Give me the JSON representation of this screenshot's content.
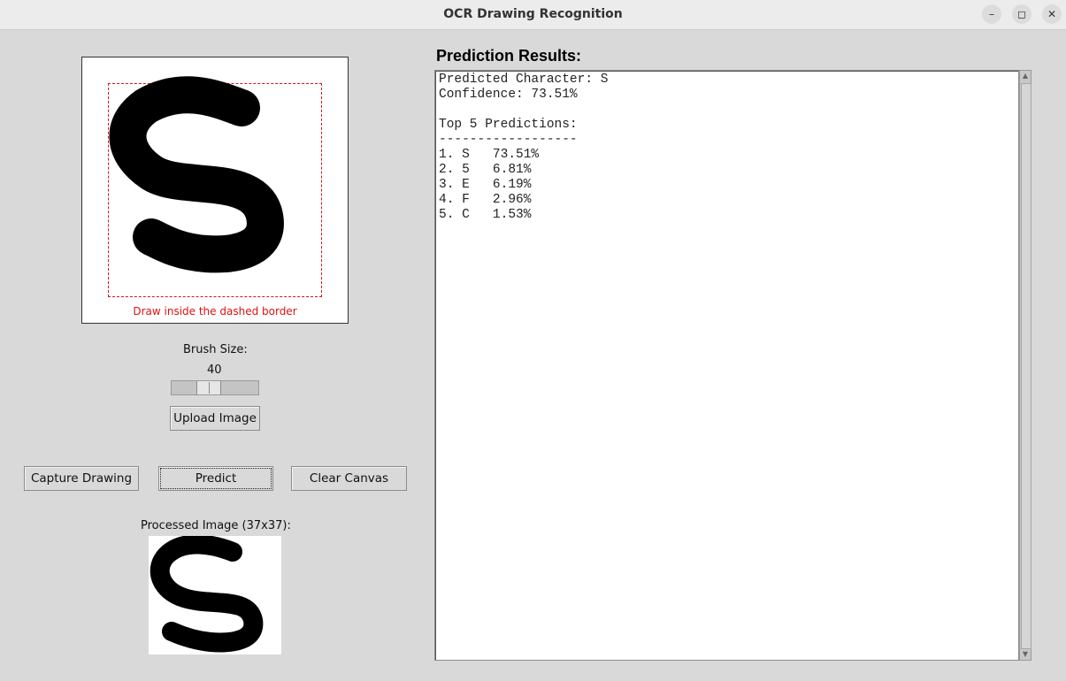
{
  "window": {
    "title": "OCR Drawing Recognition",
    "minimize": "–",
    "restore": "◻",
    "close": "✕"
  },
  "canvas": {
    "hint": "Draw inside the dashed border",
    "drawn_character": "S"
  },
  "brush": {
    "label": "Brush Size:",
    "value": "40",
    "level": 0.4
  },
  "buttons": {
    "upload": "Upload Image",
    "capture": "Capture Drawing",
    "predict": "Predict",
    "clear": "Clear Canvas"
  },
  "processed": {
    "label": "Processed Image (37x37):"
  },
  "results": {
    "title": "Prediction Results:",
    "predicted_line": "Predicted Character: S",
    "confidence_line": "Confidence: 73.51%",
    "top5_header": "Top 5 Predictions:",
    "divider": "------------------",
    "predictions": [
      "1. S   73.51%",
      "2. 5   6.81%",
      "3. E   6.19%",
      "4. F   2.96%",
      "5. C   1.53%"
    ]
  },
  "colors": {
    "background": "#d9d9d9",
    "hint": "#dd1111",
    "dashed_border": "#d41414"
  }
}
